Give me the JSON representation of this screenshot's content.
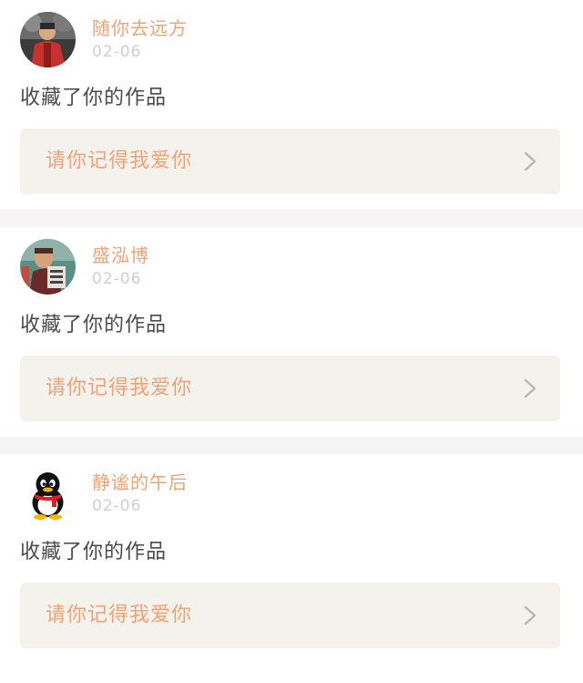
{
  "feed": {
    "items": [
      {
        "username": "随你去远方",
        "time": "02-06",
        "action": "收藏了你的作品",
        "work_title": "请你记得我爱你",
        "avatar_icon": "person-red-jacket-avatar"
      },
      {
        "username": "盛泓博",
        "time": "02-06",
        "action": "收藏了你的作品",
        "work_title": "请你记得我爱你",
        "avatar_icon": "child-photo-avatar"
      },
      {
        "username": "静谧的午后",
        "time": "02-06",
        "action": "收藏了你的作品",
        "work_title": "请你记得我爱你",
        "avatar_icon": "qq-penguin-avatar"
      }
    ]
  },
  "colors": {
    "accent": "#f0a274",
    "muted": "#cfcfcf",
    "text": "#4a4a4a",
    "box_bg": "#f3f2ec",
    "divider": "#f6f4f4"
  }
}
